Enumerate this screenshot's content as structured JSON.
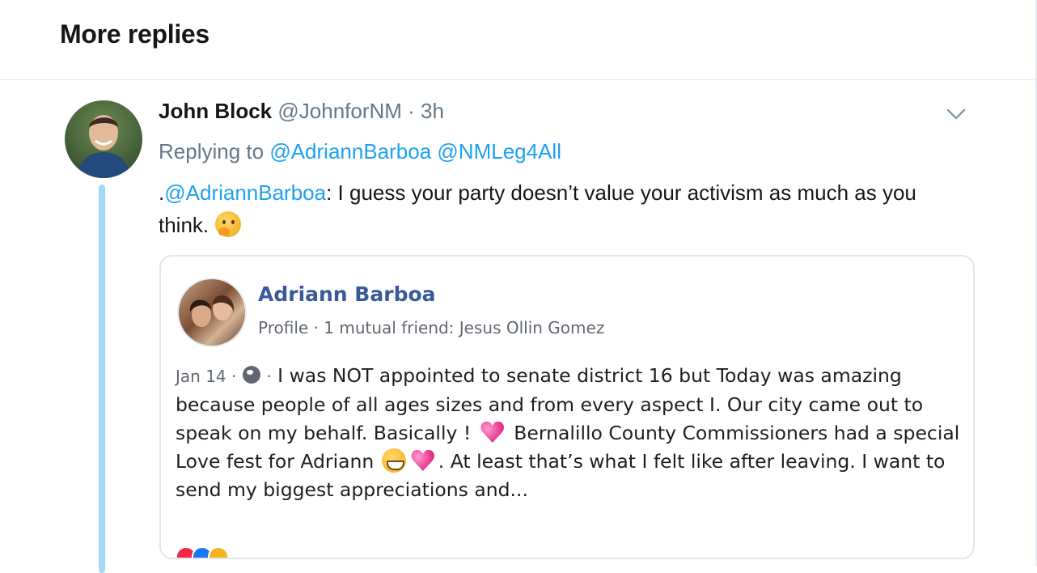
{
  "header": {
    "title": "More replies"
  },
  "tweet": {
    "author_name": "John Block",
    "author_handle": "@JohnforNM",
    "time": "· 3h",
    "replying_prefix": "Replying to",
    "replying_to": [
      "@AdriannBarboa",
      "@NMLeg4All"
    ],
    "text_prefix": ".",
    "text_mention": "@AdriannBarboa",
    "text_rest": ": I guess your party doesn’t value your activism as much as you think.",
    "emoji": "thinking-face-emoji"
  },
  "card": {
    "name": "Adriann Barboa",
    "subtitle": "Profile · 1 mutual friend: Jesus Ollin Gomez",
    "date": "Jan 14 ·",
    "date_sep": "·",
    "body_part1": "I was NOT appointed to senate district 16 but Today was amazing because people of all ages sizes and from every aspect I. Our city came out to speak on my behalf. Basically !",
    "body_part2": "Bernalillo County Commissioners had a special Love fest for Adriann",
    "body_part3": ". At least that’s what I felt like after leaving. I want to send my biggest appreciations and..."
  },
  "colors": {
    "link": "#1da1f2",
    "thread_line": "#a4d8f8",
    "fb_name": "#385898",
    "meta": "#657786"
  }
}
